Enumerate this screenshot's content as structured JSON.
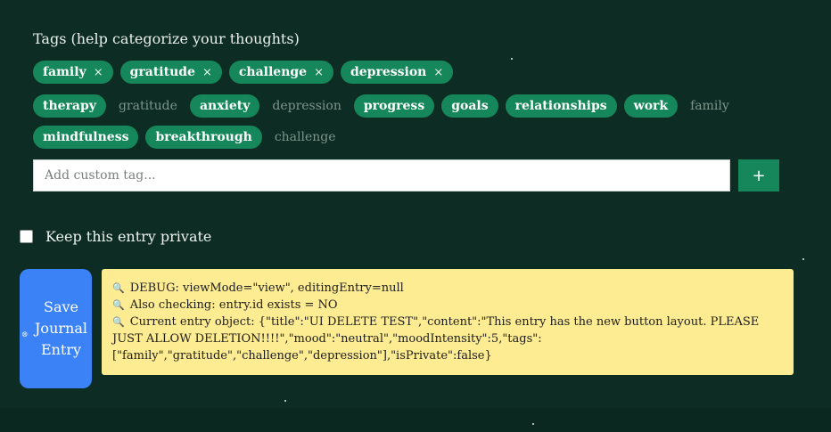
{
  "tags": {
    "label": "Tags (help categorize your thoughts)",
    "selected": [
      {
        "label": "family",
        "remove": "×"
      },
      {
        "label": "gratitude",
        "remove": "×"
      },
      {
        "label": "challenge",
        "remove": "×"
      },
      {
        "label": "depression",
        "remove": "×"
      }
    ],
    "suggestions_row1": [
      {
        "label": "therapy",
        "active": true
      },
      {
        "label": "gratitude",
        "active": false
      },
      {
        "label": "anxiety",
        "active": true
      },
      {
        "label": "depression",
        "active": false
      },
      {
        "label": "progress",
        "active": true
      },
      {
        "label": "goals",
        "active": true
      },
      {
        "label": "relationships",
        "active": true
      },
      {
        "label": "work",
        "active": true
      },
      {
        "label": "family",
        "active": false
      }
    ],
    "suggestions_row2": [
      {
        "label": "mindfulness",
        "active": true
      },
      {
        "label": "breakthrough",
        "active": true
      },
      {
        "label": "challenge",
        "active": false
      }
    ],
    "input_placeholder": "Add custom tag...",
    "add_button": "+"
  },
  "privacy": {
    "label": "Keep this entry private",
    "checked": false
  },
  "save_button": {
    "label_lines": [
      "Save",
      "Journal",
      "Entry"
    ],
    "icon": "save-icon"
  },
  "debug": {
    "lines": [
      "DEBUG: viewMode=\"view\", editingEntry=null",
      "Also checking: entry.id exists = NO",
      "Current entry object: {\"title\":\"UI DELETE TEST\",\"content\":\"This entry has the new button layout. PLEASE JUST ALLOW DELETION!!!!\",\"mood\":\"neutral\",\"moodIntensity\":5,\"tags\":[\"family\",\"gratitude\",\"challenge\",\"depression\"],\"isPrivate\":false}"
    ],
    "icon": "magnifier-icon"
  },
  "colors": {
    "accent": "#16875a",
    "save": "#3b82f6",
    "debug_bg": "#fdec92",
    "background": "#0d2d24"
  }
}
